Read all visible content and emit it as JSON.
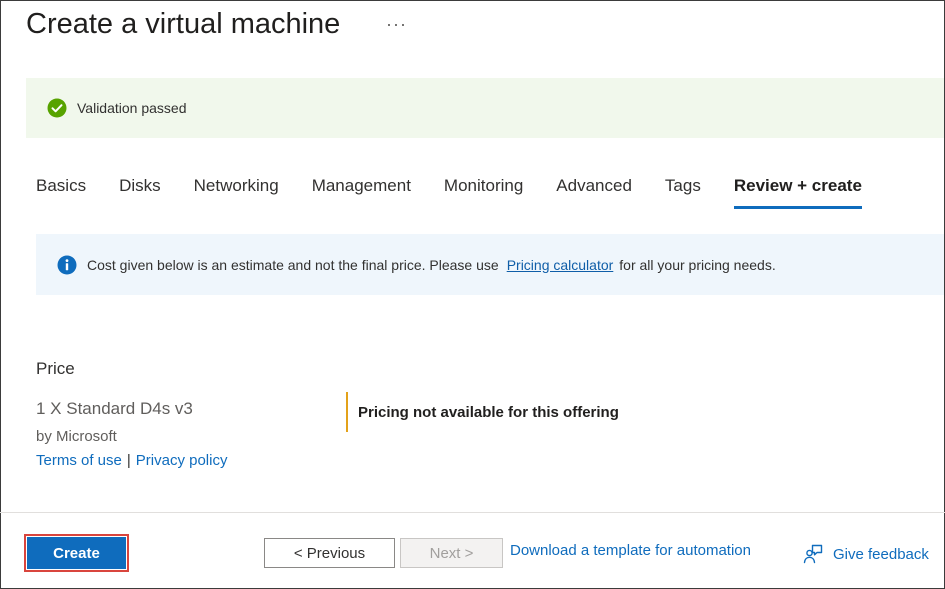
{
  "header": {
    "title": "Create a virtual machine",
    "more_label": "···"
  },
  "validation": {
    "message": "Validation passed",
    "icon": "check-circle-icon",
    "color": "#57a300"
  },
  "tabs": [
    {
      "label": "Basics"
    },
    {
      "label": "Disks"
    },
    {
      "label": "Networking"
    },
    {
      "label": "Management"
    },
    {
      "label": "Monitoring"
    },
    {
      "label": "Advanced"
    },
    {
      "label": "Tags"
    },
    {
      "label": "Review + create",
      "active": true
    }
  ],
  "info_banner": {
    "icon": "info-icon",
    "text_before": "Cost given below is an estimate and not the final price. Please use",
    "link": "Pricing calculator",
    "text_after": "for all your pricing needs."
  },
  "price": {
    "label": "Price",
    "item": "1 X Standard D4s v3",
    "vendor": "by Microsoft",
    "terms_link": "Terms of use",
    "separator": "|",
    "privacy_link": "Privacy policy",
    "note": "Pricing not available for this offering"
  },
  "footer": {
    "create_label": "Create",
    "previous_label": "< Previous",
    "next_label": "Next >",
    "download_label": "Download a template for automation",
    "feedback_label": "Give feedback"
  },
  "colors": {
    "accent": "#0f6cbd",
    "highlight_outline": "#d9453d",
    "validation_bg": "#f1f8ec",
    "info_bg": "#eff6fc",
    "note_border": "#e3a21a"
  }
}
